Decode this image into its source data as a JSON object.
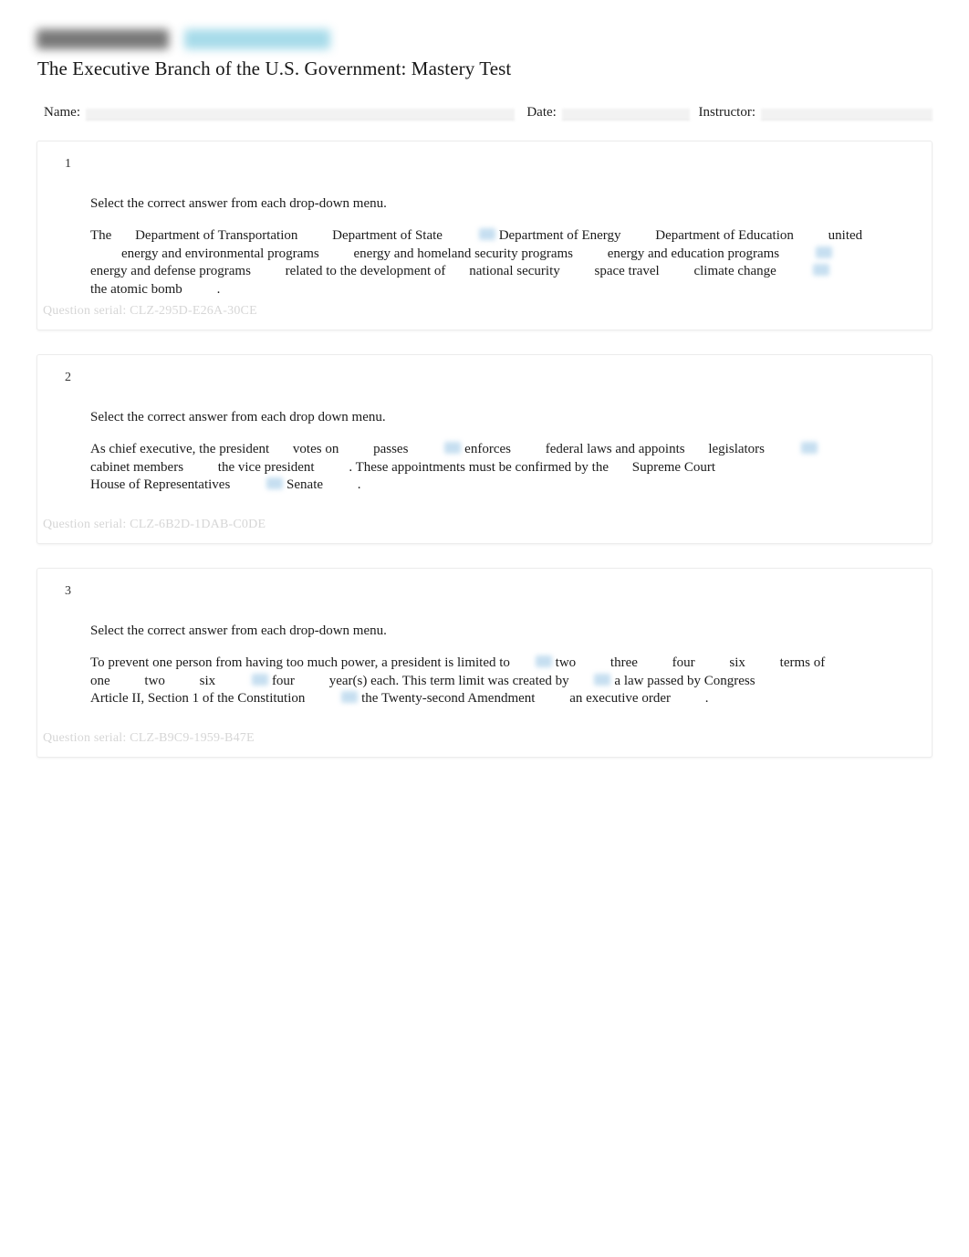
{
  "document": {
    "logo_alt": "publisher-logo",
    "title": "The Executive Branch of the U.S. Government: Mastery Test"
  },
  "meta": {
    "name_label": "Name:",
    "date_label": "Date:",
    "instructor_label": "Instructor:",
    "name_value": "",
    "date_value": "",
    "instructor_value": ""
  },
  "questions": [
    {
      "number": "1",
      "prompt": "Select the correct answer from each drop-down menu.",
      "serial_label": "Question serial: CLZ-295D-E26A-30CE",
      "segments": [
        {
          "type": "text",
          "text": "The"
        },
        {
          "type": "option",
          "text": "Department of Transportation",
          "selected": false
        },
        {
          "type": "option",
          "text": "Department of State",
          "selected": false
        },
        {
          "type": "option",
          "text": "Department of Energy",
          "selected": true
        },
        {
          "type": "option",
          "text": "Department of Education",
          "selected": false
        },
        {
          "type": "option",
          "text": "united",
          "selected": false
        },
        {
          "type": "option",
          "text": "energy and environmental programs",
          "selected": false
        },
        {
          "type": "option",
          "text": "energy and homeland security programs",
          "selected": false
        },
        {
          "type": "option",
          "text": "energy and education programs",
          "selected": false
        },
        {
          "type": "option",
          "text": "energy and defense programs",
          "selected": true
        },
        {
          "type": "text",
          "text": "related to the development of"
        },
        {
          "type": "option",
          "text": "national security",
          "selected": false
        },
        {
          "type": "option",
          "text": "space travel",
          "selected": false
        },
        {
          "type": "option",
          "text": "climate change",
          "selected": false
        },
        {
          "type": "option",
          "text": "the atomic bomb",
          "selected": true
        },
        {
          "type": "text",
          "text": "."
        }
      ]
    },
    {
      "number": "2",
      "prompt": "Select the correct answer from each drop down menu.",
      "serial_label": "Question serial: CLZ-6B2D-1DAB-C0DE",
      "segments": [
        {
          "type": "text",
          "text": "As chief executive, the president"
        },
        {
          "type": "option",
          "text": "votes on",
          "selected": false
        },
        {
          "type": "option",
          "text": "passes",
          "selected": false
        },
        {
          "type": "option",
          "text": "enforces",
          "selected": true
        },
        {
          "type": "text",
          "text": "federal laws and appoints"
        },
        {
          "type": "option",
          "text": "legislators",
          "selected": false
        },
        {
          "type": "option",
          "text": "cabinet members",
          "selected": true
        },
        {
          "type": "option",
          "text": "the vice president",
          "selected": false
        },
        {
          "type": "text",
          "text": ". These appointments must be confirmed by the"
        },
        {
          "type": "option",
          "text": "Supreme Court",
          "selected": false
        },
        {
          "type": "option",
          "text": "House of Representatives",
          "selected": false
        },
        {
          "type": "option",
          "text": "Senate",
          "selected": true
        },
        {
          "type": "text",
          "text": "."
        }
      ]
    },
    {
      "number": "3",
      "prompt": "Select the correct answer from each drop-down menu.",
      "serial_label": "Question serial: CLZ-B9C9-1959-B47E",
      "segments": [
        {
          "type": "text",
          "text": "To prevent one person from having too much power, a president is limited to"
        },
        {
          "type": "option",
          "text": "two",
          "selected": true
        },
        {
          "type": "option",
          "text": "three",
          "selected": false
        },
        {
          "type": "option",
          "text": "four",
          "selected": false
        },
        {
          "type": "option",
          "text": "six",
          "selected": false
        },
        {
          "type": "text",
          "text": "terms of"
        },
        {
          "type": "option",
          "text": "one",
          "selected": false
        },
        {
          "type": "option",
          "text": "two",
          "selected": false
        },
        {
          "type": "option",
          "text": "six",
          "selected": false
        },
        {
          "type": "option",
          "text": "four",
          "selected": true
        },
        {
          "type": "text",
          "text": "year(s) each. This term limit was created by"
        },
        {
          "type": "option",
          "text": "a law passed by Congress",
          "selected": true
        },
        {
          "type": "option",
          "text": "Article II, Section 1 of the Constitution",
          "selected": false
        },
        {
          "type": "option",
          "text": "the Twenty-second Amendment",
          "selected": true
        },
        {
          "type": "option",
          "text": "an executive order",
          "selected": false
        },
        {
          "type": "text",
          "text": "."
        }
      ]
    }
  ]
}
